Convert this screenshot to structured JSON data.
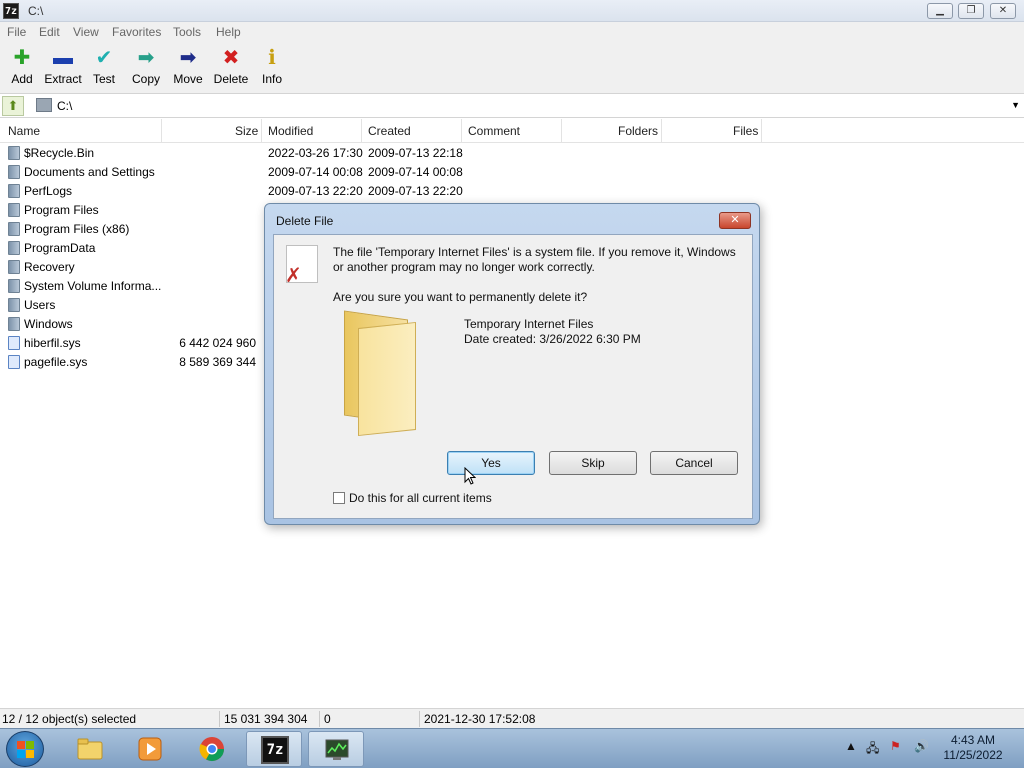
{
  "window": {
    "app_icon": "7z",
    "title": "C:\\"
  },
  "menu": [
    "File",
    "Edit",
    "View",
    "Favorites",
    "Tools",
    "Help"
  ],
  "toolbar": [
    {
      "label": "Add",
      "icon": "plus-icon",
      "color": "#2aa32a",
      "glyph": "✚"
    },
    {
      "label": "Extract",
      "icon": "minus-icon",
      "color": "#1b3fae",
      "glyph": "▬"
    },
    {
      "label": "Test",
      "icon": "check-icon",
      "color": "#1fb0b0",
      "glyph": "✔"
    },
    {
      "label": "Copy",
      "icon": "arrow-right-icon",
      "color": "#27a08a",
      "glyph": "➡"
    },
    {
      "label": "Move",
      "icon": "arrow-right-icon",
      "color": "#1f2d8a",
      "glyph": "➡"
    },
    {
      "label": "Delete",
      "icon": "delete-x-icon",
      "color": "#d22020",
      "glyph": "✖"
    },
    {
      "label": "Info",
      "icon": "info-icon",
      "color": "#c79f10",
      "glyph": "ℹ"
    }
  ],
  "address": {
    "path": "C:\\"
  },
  "columns": [
    "Name",
    "Size",
    "Modified",
    "Created",
    "Comment",
    "Folders",
    "Files"
  ],
  "files": [
    {
      "name": "$Recycle.Bin",
      "size": "",
      "modified": "2022-03-26 17:30",
      "created": "2009-07-13 22:18",
      "type": "folder"
    },
    {
      "name": "Documents and Settings",
      "size": "",
      "modified": "2009-07-14 00:08",
      "created": "2009-07-14 00:08",
      "type": "folder"
    },
    {
      "name": "PerfLogs",
      "size": "",
      "modified": "2009-07-13 22:20",
      "created": "2009-07-13 22:20",
      "type": "folder"
    },
    {
      "name": "Program Files",
      "size": "",
      "modified": "",
      "created": "",
      "type": "folder"
    },
    {
      "name": "Program Files (x86)",
      "size": "",
      "modified": "",
      "created": "",
      "type": "folder"
    },
    {
      "name": "ProgramData",
      "size": "",
      "modified": "",
      "created": "",
      "type": "folder"
    },
    {
      "name": "Recovery",
      "size": "",
      "modified": "",
      "created": "",
      "type": "folder"
    },
    {
      "name": "System Volume Informa...",
      "size": "",
      "modified": "",
      "created": "",
      "type": "folder"
    },
    {
      "name": "Users",
      "size": "",
      "modified": "",
      "created": "",
      "type": "folder"
    },
    {
      "name": "Windows",
      "size": "",
      "modified": "",
      "created": "",
      "type": "folder"
    },
    {
      "name": "hiberfil.sys",
      "size": "6 442 024 960",
      "modified": "",
      "created": "",
      "type": "file"
    },
    {
      "name": "pagefile.sys",
      "size": "8 589 369 344",
      "modified": "",
      "created": "",
      "type": "file"
    }
  ],
  "status": {
    "selected": "12 / 12 object(s) selected",
    "total_size": "15 031 394 304",
    "count": "0",
    "date": "2021-12-30 17:52:08"
  },
  "dialog": {
    "title": "Delete File",
    "close_glyph": "✕",
    "message": "The file 'Temporary Internet Files' is a system file. If you remove it, Windows or another program may no longer work correctly.",
    "question": "Are you sure you want to permanently delete it?",
    "file_name": "Temporary Internet Files",
    "date_created": "Date created: 3/26/2022 6:30 PM",
    "yes": "Yes",
    "skip": "Skip",
    "cancel": "Cancel",
    "checkbox_label": "Do this for all current items",
    "checkbox_checked": false
  },
  "taskbar": {
    "time": "4:43 AM",
    "date": "11/25/2022",
    "app_7z_label": "7z"
  }
}
